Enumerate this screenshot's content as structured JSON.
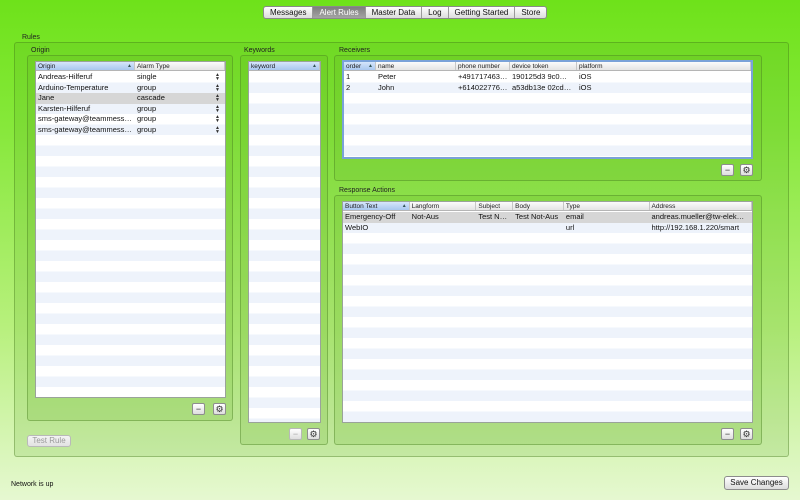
{
  "tabs": [
    "Messages",
    "Alert Rules",
    "Master Data",
    "Log",
    "Getting Started",
    "Store"
  ],
  "active_tab": "Alert Rules",
  "rules_label": "Rules",
  "origin": {
    "label": "Origin",
    "columns": [
      "Origin",
      "Alarm Type"
    ],
    "rows": [
      {
        "origin": "Andreas-Hilferuf",
        "type": "single"
      },
      {
        "origin": "Arduino-Temperature",
        "type": "group"
      },
      {
        "origin": "Jane",
        "type": "cascade"
      },
      {
        "origin": "Karsten-Hilferuf",
        "type": "group"
      },
      {
        "origin": "sms-gateway@teammess…",
        "type": "group"
      },
      {
        "origin": "sms-gateway@teammess…",
        "type": "group"
      }
    ],
    "selected_row": 2
  },
  "keywords": {
    "label": "Keywords",
    "columns": [
      "keyword"
    ]
  },
  "receivers": {
    "label": "Receivers",
    "columns": [
      "order",
      "name",
      "phone number",
      "device token",
      "platform"
    ],
    "rows": [
      {
        "order": "1",
        "name": "Peter",
        "phone": "+491717463…",
        "token": "190125d3 9c0…",
        "platform": "iOS"
      },
      {
        "order": "2",
        "name": "John",
        "phone": "+614022776…",
        "token": "a53db13e 02cd…",
        "platform": "iOS"
      }
    ]
  },
  "response_actions": {
    "label": "Response Actions",
    "columns": [
      "Button Text",
      "Langform",
      "Subject",
      "Body",
      "Type",
      "Address"
    ],
    "rows": [
      {
        "button": "Emergency-Off",
        "langform": "Not-Aus",
        "subject": "Test N…",
        "body": "Test Not-Aus",
        "type": "email",
        "address": "andreas.mueller@tw-elek…"
      },
      {
        "button": "WebIO",
        "langform": "",
        "subject": "",
        "body": "",
        "type": "url",
        "address": "http://192.168.1.220/smart"
      }
    ],
    "selected_row": 0
  },
  "buttons": {
    "minus": "−",
    "gear": "⚙",
    "test_rule": "Test Rule",
    "save_changes": "Save Changes"
  },
  "status_text": "Network is up"
}
